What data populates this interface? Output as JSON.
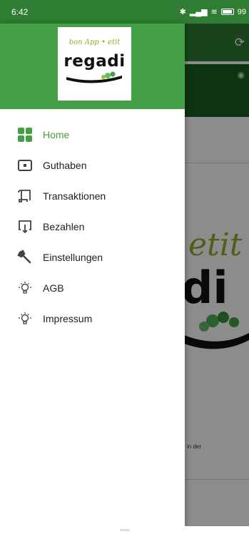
{
  "status_bar": {
    "time": "6:42",
    "battery": "99"
  },
  "background": {
    "footer_text": "in der"
  },
  "drawer": {
    "logo": {
      "script_text": "bon App • etit",
      "word": "regadi"
    },
    "items": [
      {
        "label": "Home",
        "icon": "home-grid-icon",
        "active": true
      },
      {
        "label": "Guthaben",
        "icon": "wallet-icon",
        "active": false
      },
      {
        "label": "Transaktionen",
        "icon": "scroll-icon",
        "active": false
      },
      {
        "label": "Bezahlen",
        "icon": "pay-terminal-icon",
        "active": false
      },
      {
        "label": "Einstellungen",
        "icon": "wrench-icon",
        "active": false
      },
      {
        "label": "AGB",
        "icon": "lightbulb-icon",
        "active": false
      },
      {
        "label": "Impressum",
        "icon": "lightbulb-icon",
        "active": false
      }
    ]
  },
  "colors": {
    "accent": "#43a047",
    "toolbar": "#2e7d32",
    "text": "#212121",
    "icon": "#424242"
  }
}
